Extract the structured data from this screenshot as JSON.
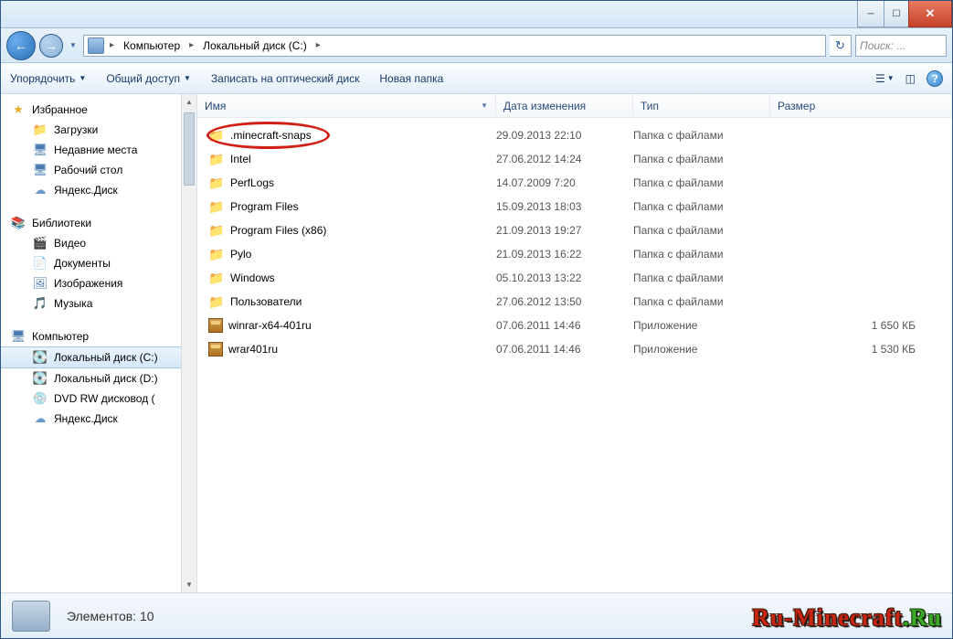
{
  "breadcrumb": {
    "segments": [
      "Компьютер",
      "Локальный диск (C:)"
    ]
  },
  "search": {
    "placeholder": "Поиск: ..."
  },
  "toolbar": {
    "organize": "Упорядочить",
    "share": "Общий доступ",
    "burn": "Записать на оптический диск",
    "new_folder": "Новая папка"
  },
  "sidebar": {
    "favorites": {
      "label": "Избранное",
      "items": [
        "Загрузки",
        "Недавние места",
        "Рабочий стол",
        "Яндекс.Диск"
      ]
    },
    "libraries": {
      "label": "Библиотеки",
      "items": [
        "Видео",
        "Документы",
        "Изображения",
        "Музыка"
      ]
    },
    "computer": {
      "label": "Компьютер",
      "items": [
        "Локальный диск (C:)",
        "Локальный диск (D:)",
        "DVD RW дисковод (",
        "Яндекс.Диск"
      ]
    }
  },
  "columns": {
    "name": "Имя",
    "date": "Дата изменения",
    "type": "Тип",
    "size": "Размер"
  },
  "files": [
    {
      "name": ".minecraft-snaps",
      "date": "29.09.2013 22:10",
      "type": "Папка с файлами",
      "size": "",
      "icon": "folder"
    },
    {
      "name": "Intel",
      "date": "27.06.2012 14:24",
      "type": "Папка с файлами",
      "size": "",
      "icon": "folder"
    },
    {
      "name": "PerfLogs",
      "date": "14.07.2009 7:20",
      "type": "Папка с файлами",
      "size": "",
      "icon": "folder"
    },
    {
      "name": "Program Files",
      "date": "15.09.2013 18:03",
      "type": "Папка с файлами",
      "size": "",
      "icon": "folder"
    },
    {
      "name": "Program Files (x86)",
      "date": "21.09.2013 19:27",
      "type": "Папка с файлами",
      "size": "",
      "icon": "folder"
    },
    {
      "name": "Pylo",
      "date": "21.09.2013 16:22",
      "type": "Папка с файлами",
      "size": "",
      "icon": "folder"
    },
    {
      "name": "Windows",
      "date": "05.10.2013 13:22",
      "type": "Папка с файлами",
      "size": "",
      "icon": "folder"
    },
    {
      "name": "Пользователи",
      "date": "27.06.2012 13:50",
      "type": "Папка с файлами",
      "size": "",
      "icon": "folder"
    },
    {
      "name": "winrar-x64-401ru",
      "date": "07.06.2011 14:46",
      "type": "Приложение",
      "size": "1 650 КБ",
      "icon": "app"
    },
    {
      "name": "wrar401ru",
      "date": "07.06.2011 14:46",
      "type": "Приложение",
      "size": "1 530 КБ",
      "icon": "app"
    }
  ],
  "status": {
    "label": "Элементов:",
    "count": "10"
  },
  "watermark": {
    "part1": "Ru-Minecraft",
    "part2": ".Ru"
  }
}
